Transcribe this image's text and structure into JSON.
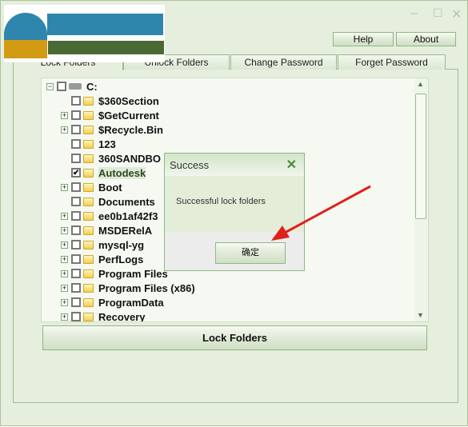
{
  "window": {
    "controls": [
      "minimize",
      "maximize",
      "close"
    ]
  },
  "header": {
    "help": "Help",
    "about": "About"
  },
  "tabs": [
    {
      "label": "Lock Folders",
      "active": true
    },
    {
      "label": "Unlock Folders"
    },
    {
      "label": "Change Password"
    },
    {
      "label": "Forget Password"
    }
  ],
  "tree": {
    "root": "C:",
    "items": [
      {
        "name": "$360Section",
        "expandable": false,
        "checked": false
      },
      {
        "name": "$GetCurrent",
        "expandable": true,
        "checked": false
      },
      {
        "name": "$Recycle.Bin",
        "expandable": true,
        "checked": false
      },
      {
        "name": "123",
        "expandable": false,
        "checked": false
      },
      {
        "name": "360SANDBO",
        "expandable": false,
        "checked": false
      },
      {
        "name": "Autodesk",
        "expandable": false,
        "checked": true
      },
      {
        "name": "Boot",
        "expandable": true,
        "checked": false
      },
      {
        "name": "Documents",
        "expandable": false,
        "checked": false
      },
      {
        "name": "ee0b1af42f3",
        "expandable": true,
        "checked": false
      },
      {
        "name": "MSDERelA",
        "expandable": true,
        "checked": false
      },
      {
        "name": "mysql-yg",
        "expandable": true,
        "checked": false
      },
      {
        "name": "PerfLogs",
        "expandable": true,
        "checked": false
      },
      {
        "name": "Program Files",
        "expandable": true,
        "checked": false
      },
      {
        "name": "Program Files (x86)",
        "expandable": true,
        "checked": false
      },
      {
        "name": "ProgramData",
        "expandable": true,
        "checked": false
      },
      {
        "name": "Recovery",
        "expandable": true,
        "checked": false
      }
    ]
  },
  "lock_button": "Lock Folders",
  "dialog": {
    "title": "Success",
    "message": "Successful lock folders",
    "ok": "确定"
  },
  "colors": {
    "accent": "#8fb882",
    "arrow": "#e0201c"
  }
}
